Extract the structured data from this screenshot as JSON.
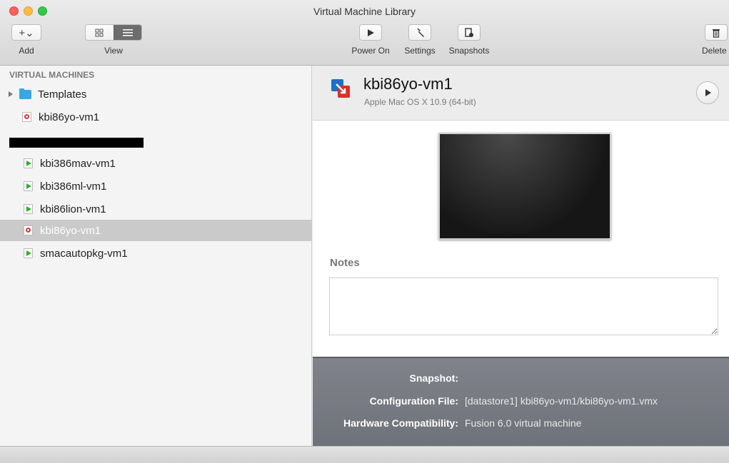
{
  "window": {
    "title": "Virtual Machine Library"
  },
  "toolbar": {
    "add_label": "Add",
    "add_symbol": "+⌄",
    "view_label": "View",
    "power_on_label": "Power On",
    "settings_label": "Settings",
    "snapshots_label": "Snapshots",
    "delete_label": "Delete"
  },
  "sidebar": {
    "header": "VIRTUAL MACHINES",
    "items": [
      {
        "label": "Templates",
        "type": "folder"
      },
      {
        "label": "kbi86yo-vm1",
        "type": "vm",
        "state": "suspended"
      },
      {
        "label": "kbi386mav-vm1",
        "type": "vm",
        "state": "running"
      },
      {
        "label": "kbi386ml-vm1",
        "type": "vm",
        "state": "running"
      },
      {
        "label": "kbi86lion-vm1",
        "type": "vm",
        "state": "running"
      },
      {
        "label": "kbi86yo-vm1",
        "type": "vm",
        "state": "suspended",
        "selected": true
      },
      {
        "label": "smacautopkg-vm1",
        "type": "vm",
        "state": "running"
      }
    ]
  },
  "detail": {
    "vm_name": "kbi86yo-vm1",
    "os": "Apple Mac OS X 10.9 (64-bit)",
    "notes_label": "Notes",
    "notes_value": "",
    "info": [
      {
        "key": "Snapshot:",
        "value": ""
      },
      {
        "key": "Configuration File:",
        "value": "[datastore1] kbi86yo-vm1/kbi86yo-vm1.vmx"
      },
      {
        "key": "Hardware Compatibility:",
        "value": "Fusion 6.0 virtual machine"
      }
    ]
  },
  "colors": {
    "accent": "#39a7e4",
    "running": "#2eaf2e",
    "suspended": "#dd3333"
  }
}
